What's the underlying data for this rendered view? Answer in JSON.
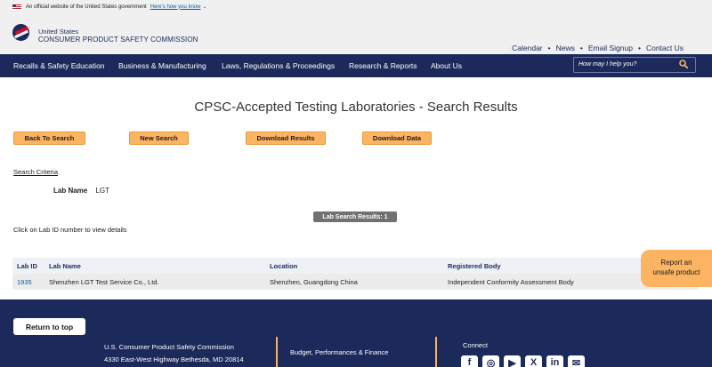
{
  "banner": {
    "text": "An official website of the United States government",
    "link": "Here's how you know"
  },
  "agency": {
    "line1": "United States",
    "line2": "CONSUMER PRODUCT SAFETY COMMISSION"
  },
  "utility_nav": [
    "Calendar",
    "News",
    "Email Signup",
    "Contact Us"
  ],
  "main_nav": [
    "Recalls & Safety Education",
    "Business & Manufacturing",
    "Laws, Regulations & Proceedings",
    "Research & Reports",
    "About Us"
  ],
  "search": {
    "placeholder": "How may I help you?"
  },
  "page": {
    "title": "CPSC-Accepted Testing Laboratories - Search Results",
    "buttons": {
      "back": "Back To Search",
      "new": "New Search",
      "download_results": "Download Results",
      "download_data": "Download Data"
    },
    "criteria_label": "Search Criteria",
    "criteria": {
      "key": "Lab Name",
      "value": "LGT"
    },
    "results_badge": "Lab Search Results: 1",
    "hint": "Click on Lab ID number to view details"
  },
  "table": {
    "headers": [
      "Lab ID",
      "Lab Name",
      "Location",
      "Registered Body"
    ],
    "rows": [
      [
        "1935",
        "Shenzhen LGT Test Service Co., Ltd.",
        "Shenzhen, Guangdong China",
        "Independent Conformity Assessment Body"
      ]
    ]
  },
  "report_tab": {
    "line1": "Report an",
    "line2": "unsafe product"
  },
  "footer": {
    "return_top": "Return to top",
    "org": "U.S. Consumer Product Safety Commission",
    "address": "4330 East-West Highway Bethesda, MD 20814",
    "budget": "Budget, Performances & Finance",
    "connect": "Connect",
    "social_icons": [
      "facebook-icon",
      "instagram-icon",
      "youtube-icon",
      "x-icon",
      "linkedin-icon",
      "email-icon"
    ]
  },
  "colors": {
    "navy": "#1b2a5b",
    "accent": "#fdb462",
    "link": "#005ea2"
  }
}
